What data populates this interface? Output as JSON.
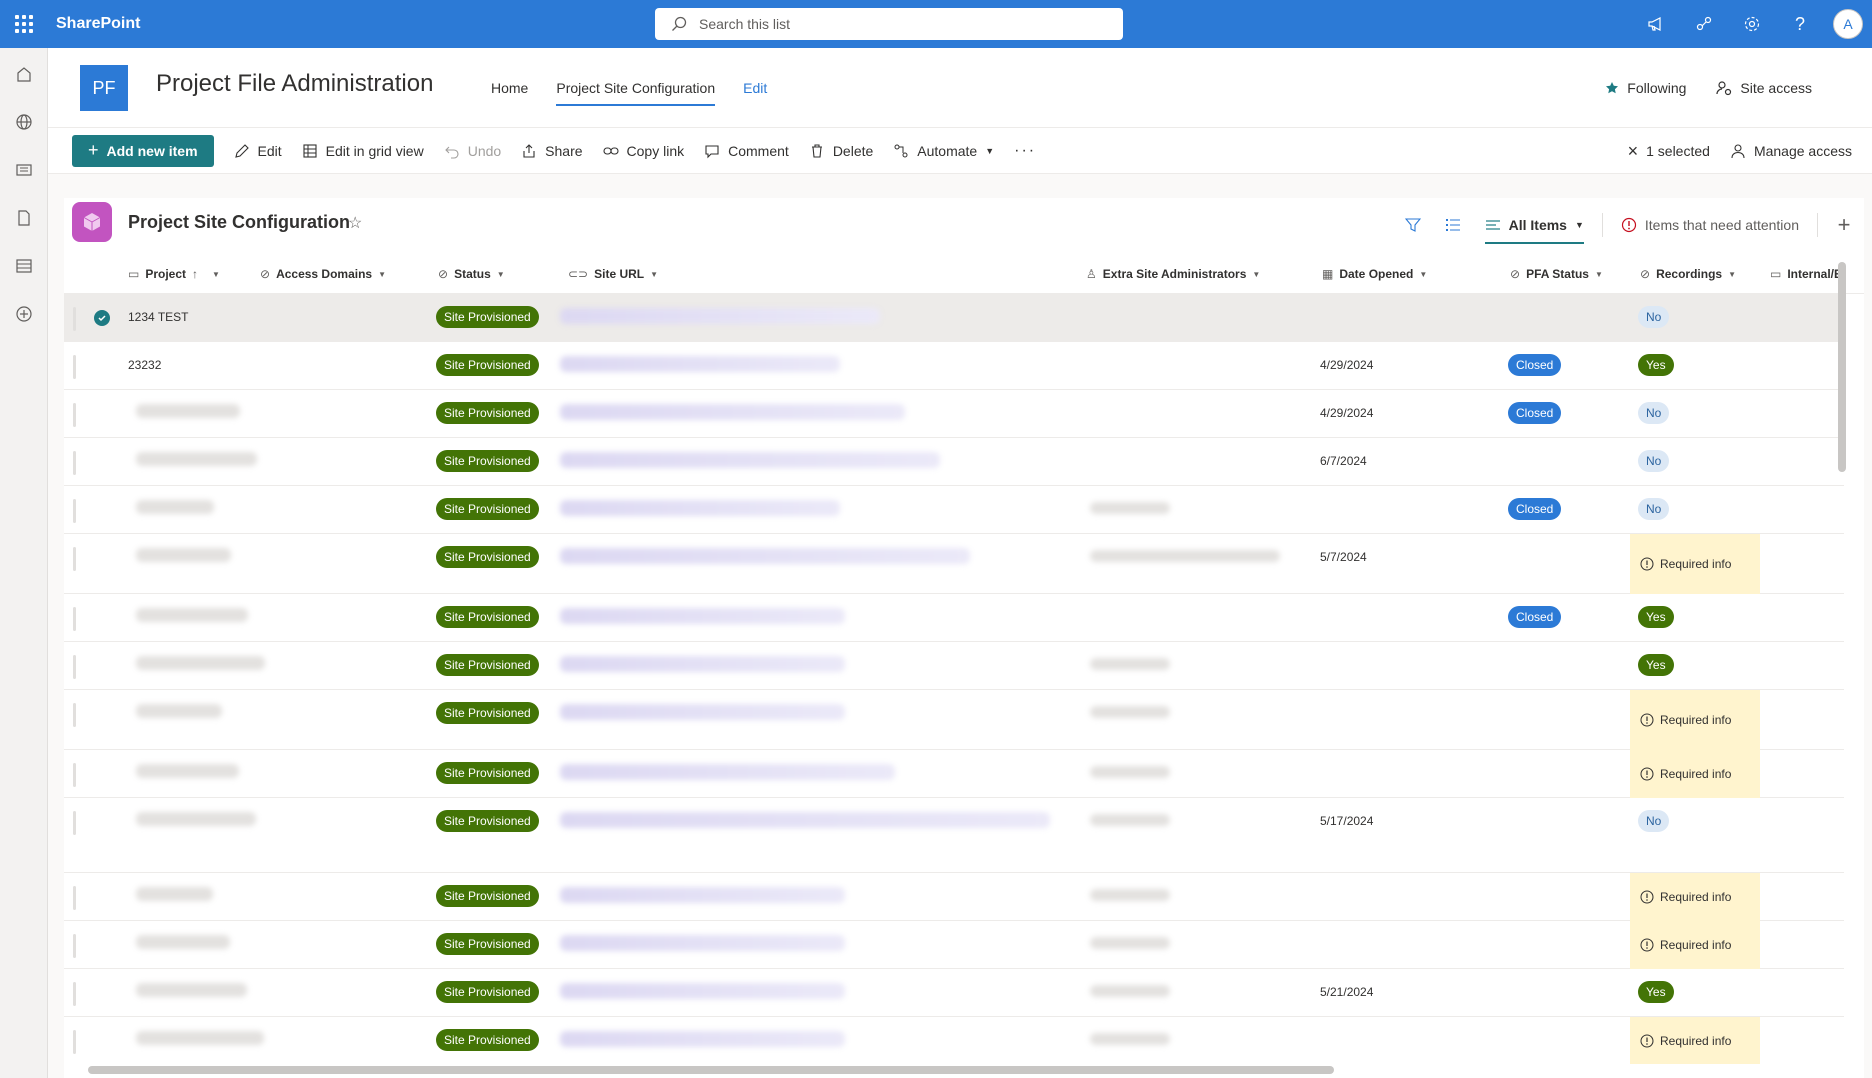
{
  "suite": {
    "brand": "SharePoint",
    "search_placeholder": "Search this list",
    "avatar_initial": "A"
  },
  "site": {
    "logo": "PF",
    "title": "Project File Administration",
    "nav": [
      "Home",
      "Project Site Configuration",
      "Edit"
    ],
    "following": "Following",
    "site_access": "Site access"
  },
  "commands": {
    "add_new": "Add new item",
    "edit": "Edit",
    "grid": "Edit in grid view",
    "undo": "Undo",
    "share": "Share",
    "copy": "Copy link",
    "comment": "Comment",
    "delete": "Delete",
    "automate": "Automate",
    "selected": "1 selected",
    "manage": "Manage access"
  },
  "list": {
    "title": "Project Site Configuration",
    "views": {
      "all": "All Items",
      "attention": "Items that need attention"
    }
  },
  "columns": [
    "Project",
    "Access Domains",
    "Status",
    "Site URL",
    "Extra Site Administrators",
    "Date Opened",
    "PFA Status",
    "Recordings",
    "Internal/E"
  ],
  "rows": [
    {
      "project": "1234 TEST",
      "status": "Site Provisioned",
      "date": "",
      "pfa": "",
      "rec": "No"
    },
    {
      "project": "23232",
      "status": "Site Provisioned",
      "date": "4/29/2024",
      "pfa": "Closed",
      "rec": "Yes"
    },
    {
      "project": "",
      "status": "Site Provisioned",
      "date": "4/29/2024",
      "pfa": "Closed",
      "rec": "No"
    },
    {
      "project": "",
      "status": "Site Provisioned",
      "date": "6/7/2024",
      "pfa": "",
      "rec": "No"
    },
    {
      "project": "",
      "status": "Site Provisioned",
      "date": "",
      "pfa": "Closed",
      "rec": "No"
    },
    {
      "project": "",
      "status": "Site Provisioned",
      "date": "5/7/2024",
      "pfa": "",
      "rec": "Required info"
    },
    {
      "project": "",
      "status": "Site Provisioned",
      "date": "",
      "pfa": "Closed",
      "rec": "Yes"
    },
    {
      "project": "",
      "status": "Site Provisioned",
      "date": "",
      "pfa": "",
      "rec": "Yes"
    },
    {
      "project": "",
      "status": "Site Provisioned",
      "date": "",
      "pfa": "",
      "rec": "Required info"
    },
    {
      "project": "",
      "status": "Site Provisioned",
      "date": "",
      "pfa": "",
      "rec": "Required info"
    },
    {
      "project": "",
      "status": "Site Provisioned",
      "date": "5/17/2024",
      "pfa": "",
      "rec": "No"
    },
    {
      "project": "",
      "status": "Site Provisioned",
      "date": "",
      "pfa": "",
      "rec": "Required info"
    },
    {
      "project": "",
      "status": "Site Provisioned",
      "date": "",
      "pfa": "",
      "rec": "Required info"
    },
    {
      "project": "",
      "status": "Site Provisioned",
      "date": "5/21/2024",
      "pfa": "",
      "rec": "Yes"
    },
    {
      "project": "",
      "status": "Site Provisioned",
      "date": "",
      "pfa": "",
      "rec": "Required info"
    }
  ]
}
